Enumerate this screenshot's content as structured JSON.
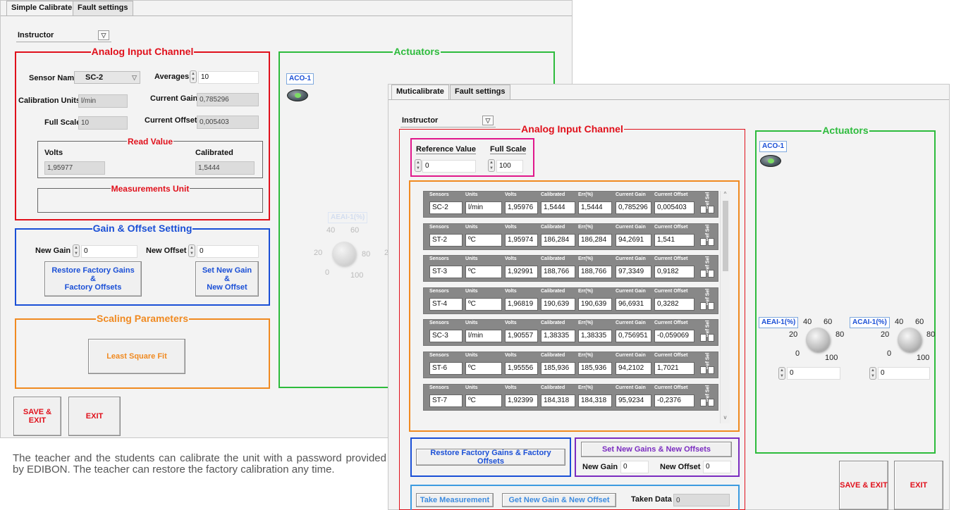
{
  "win1": {
    "tabs": [
      "Simple Calibrate",
      "Fault settings"
    ],
    "user": "Instructor",
    "analog_title": "Analog Input Channel",
    "sensor_name_label": "Sensor Name",
    "sensor_name_value": "SC-2",
    "averages_label": "Averages",
    "averages_value": "10",
    "cal_units_label": "Calibration Units",
    "cal_units_value": "l/min",
    "current_gain_label": "Current Gain",
    "current_gain_value": "0,785296",
    "full_scale_label": "Full Scale",
    "full_scale_value": "10",
    "current_offset_label": "Current Offset",
    "current_offset_value": "0,005403",
    "read_value_title": "Read Value",
    "volts_label": "Volts",
    "volts_value": "1,95977",
    "calibrated_label": "Calibrated",
    "calibrated_value": "1,5444",
    "meas_unit_title": "Measurements Unit",
    "gain_title": "Gain & Offset Setting",
    "new_gain_label": "New Gain",
    "new_gain_value": "0",
    "new_offset_label": "New Offset",
    "new_offset_value": "0",
    "restore_btn": "Restore  Factory Gains\n&\nFactory Offsets",
    "set_btn": "Set  New Gain\n&\nNew Offset",
    "scaling_title": "Scaling Parameters",
    "lsq_btn": "Least Square Fit",
    "save_exit": "SAVE & EXIT",
    "exit": "EXIT",
    "actuators_title": "Actuators",
    "aco_label": "ACO-1",
    "knob_label": "AEAI-1(%)",
    "ticks": [
      "40",
      "60",
      "20",
      "80",
      "0",
      "100"
    ],
    "tick_2": "2"
  },
  "win2": {
    "tabs": [
      "Muticalibrate",
      "Fault settings"
    ],
    "user": "Instructor",
    "analog_title": "Analog Input Channel",
    "ref_value_label": "Reference Value",
    "ref_value": "0",
    "full_scale_label": "Full Scale",
    "full_scale_value": "100",
    "table_headers": [
      "Sensors",
      "Units",
      "Volts",
      "Calibrated",
      "Err(%)",
      "Current Gain",
      "Current Offset"
    ],
    "ref_sel": "Ref Sel",
    "rows": [
      [
        "SC-2",
        "l/min",
        "1,95976",
        "1,5444",
        "1,5444",
        "0,785296",
        "0,005403"
      ],
      [
        "ST-2",
        "ºC",
        "1,95974",
        "186,284",
        "186,284",
        "94,2691",
        "1,541"
      ],
      [
        "ST-3",
        "ºC",
        "1,92991",
        "188,766",
        "188,766",
        "97,3349",
        "0,9182"
      ],
      [
        "ST-4",
        "ºC",
        "1,96819",
        "190,639",
        "190,639",
        "96,6931",
        "0,3282"
      ],
      [
        "SC-3",
        "l/min",
        "1,90557",
        "1,38335",
        "1,38335",
        "0,756951",
        "-0,059069"
      ],
      [
        "ST-6",
        "ºC",
        "1,95556",
        "185,936",
        "185,936",
        "94,2102",
        "1,7021"
      ],
      [
        "ST-7",
        "ºC",
        "1,92399",
        "184,318",
        "184,318",
        "95,9234",
        "-0,2376"
      ]
    ],
    "restore_btn": "Restore  Factory Gains & Factory Offsets",
    "set_title": "Set  New Gains & New Offsets",
    "new_gain_label": "New Gain",
    "new_gain_value": "0",
    "new_offset_label": "New Offset",
    "new_offset_value": "0",
    "take_btn": "Take Measurement",
    "get_btn": "Get New Gain &  New Offset",
    "taken_label": "Taken Data",
    "taken_value": "0",
    "actuators_title": "Actuators",
    "aco_label": "ACO-1",
    "aeai_label": "AEAI-1(%)",
    "acai_label": "ACAI-1(%)",
    "ticks": [
      "40",
      "60",
      "20",
      "80",
      "0",
      "100"
    ],
    "knob1_value": "0",
    "knob2_value": "0",
    "save_exit": "SAVE & EXIT",
    "exit": "EXIT"
  },
  "caption": "The teacher and the students can calibrate the unit with a password provided by EDIBON. The teacher can restore the factory calibration any time.",
  "colors": {
    "red": "#e0101b",
    "blue": "#1a4fd6",
    "green": "#2dbb3c",
    "orange": "#f08a21",
    "pink": "#e0188c",
    "purple": "#7b2cc0"
  }
}
